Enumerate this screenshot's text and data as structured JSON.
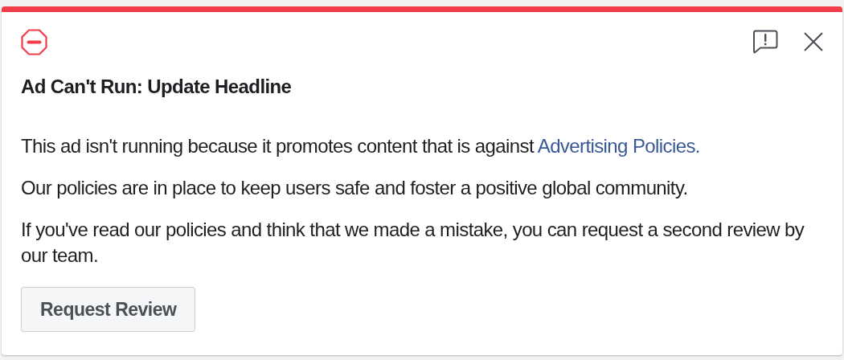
{
  "alert": {
    "kind": "error",
    "title": "Ad Can't Run: Update Headline",
    "paragraphs": [
      {
        "text": "This ad isn't running because it promotes content that is against ",
        "link": "Advertising Policies."
      },
      {
        "text": "Our policies are in place to keep users safe and foster a positive global community."
      },
      {
        "text": "If you've read our policies and think that we made a mistake, you can request a second review by our team."
      }
    ],
    "button": "Request Review"
  }
}
